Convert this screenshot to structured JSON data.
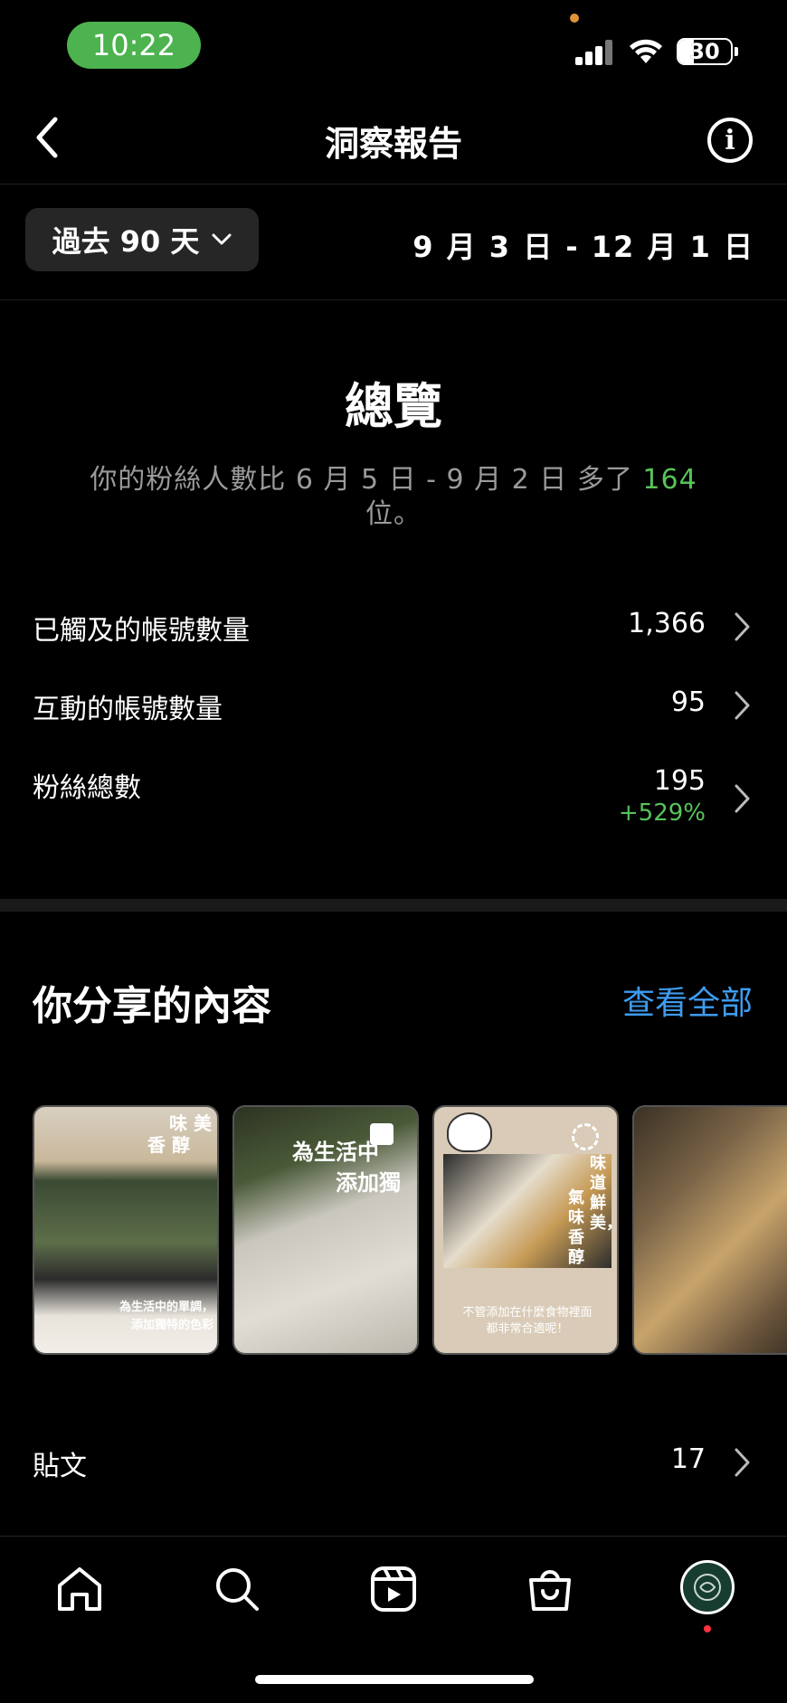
{
  "status_bar": {
    "time": "10:22",
    "battery": "30"
  },
  "header": {
    "title": "洞察報告",
    "info_icon": "info-icon",
    "back_icon": "chevron-left-icon"
  },
  "date_filter": {
    "range_label": "過去 90 天",
    "date_range": "9 月 3 日 - 12 月 1 日"
  },
  "overview": {
    "title": "總覽",
    "desc_prefix": "你的粉絲人數比 6 月 5 日 - 9 月 2 日 多了",
    "desc_number": "164",
    "desc_suffix": "位。",
    "metrics": [
      {
        "label": "已觸及的帳號數量",
        "value": "1,366",
        "sub": ""
      },
      {
        "label": "互動的帳號數量",
        "value": "95",
        "sub": ""
      },
      {
        "label": "粉絲總數",
        "value": "195",
        "sub": "+529%"
      }
    ]
  },
  "content": {
    "title": "你分享的內容",
    "see_all": "查看全部",
    "thumbnails": [
      {
        "caption_top": "味 美",
        "caption_top2": "香 醇",
        "caption_bottom": "為生活中的單調，",
        "caption_bottom2": "添加獨特的色彩"
      },
      {
        "caption_top": "為生活中",
        "caption_top2": "添加獨"
      },
      {
        "caption_top": "味道鮮美，",
        "caption_top2": "氣味香醇",
        "line1": "不管添加在什麼食物裡面",
        "line2": "都非常合適呢！"
      },
      {
        "caption_top": ""
      }
    ],
    "rows": [
      {
        "label": "貼文",
        "value": "17"
      }
    ]
  },
  "colors": {
    "accent_green": "#58c35a",
    "link_blue": "#3e9cf0",
    "status_pill": "#4cb34f"
  },
  "tabs": [
    "home-icon",
    "search-icon",
    "reels-icon",
    "shop-icon",
    "profile-avatar"
  ]
}
